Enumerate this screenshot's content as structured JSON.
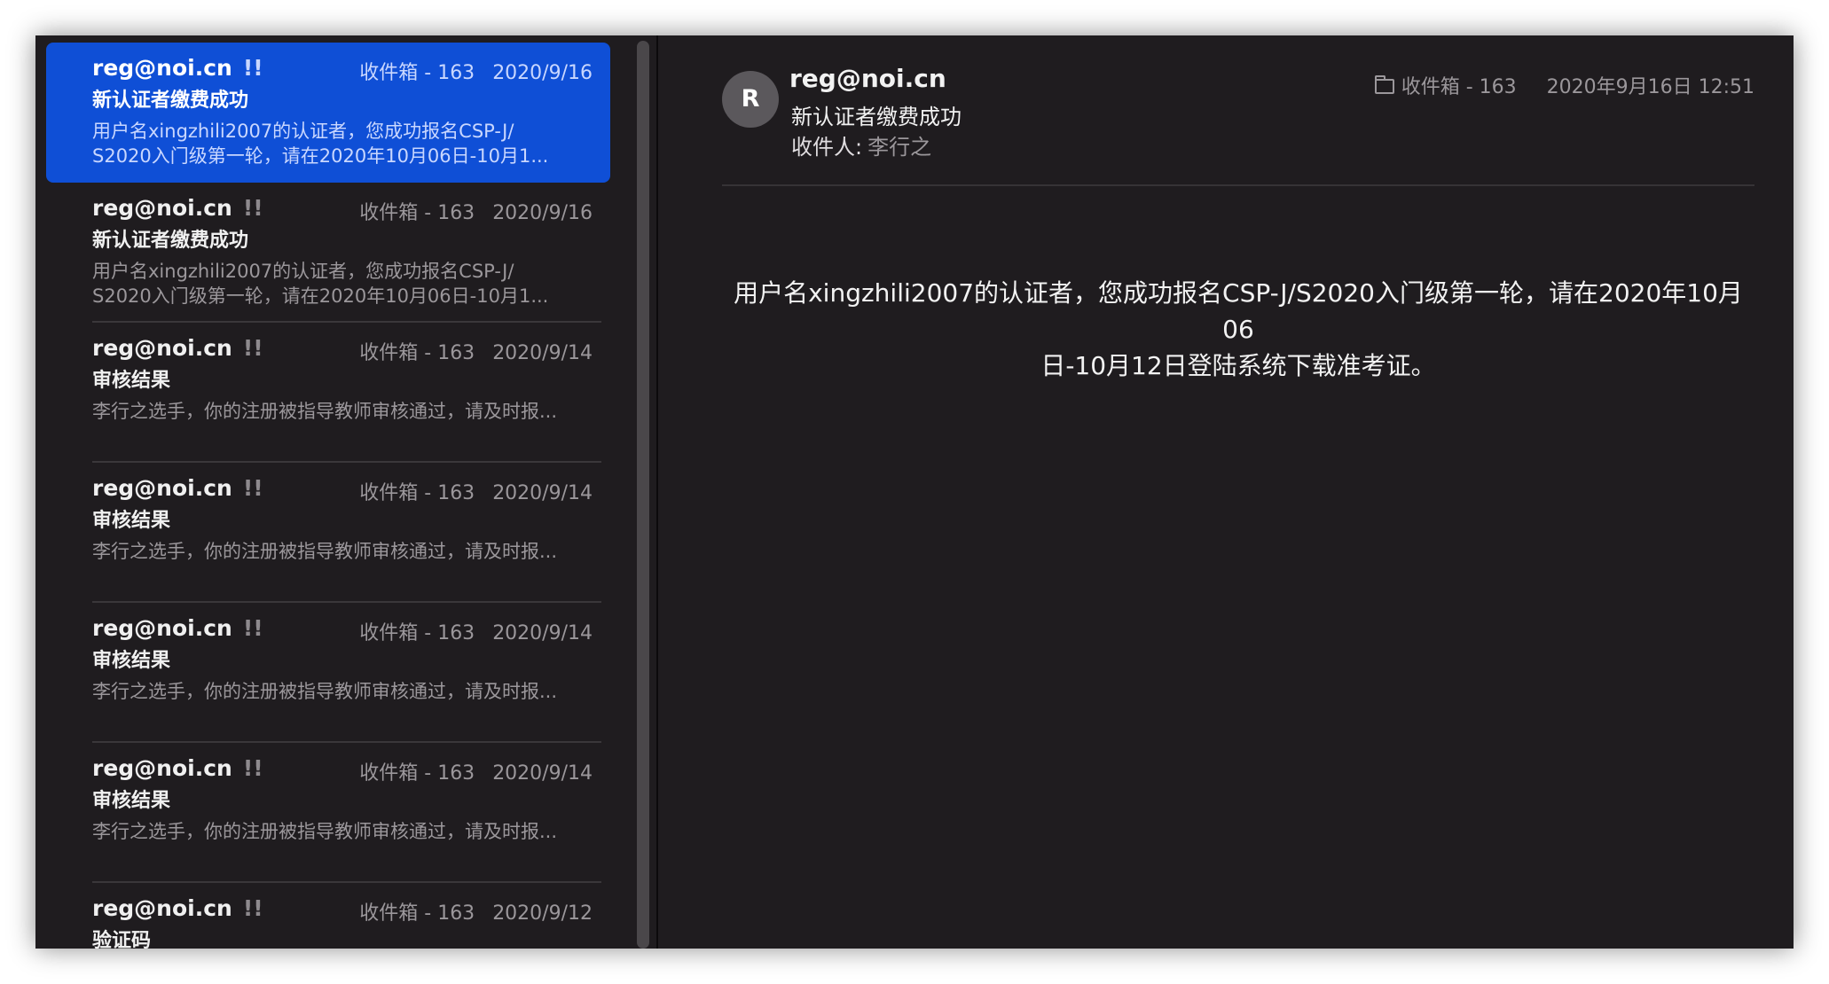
{
  "colors": {
    "window_bg": "#1f1c1f",
    "selected_bg": "#0f4fd6",
    "muted_text": "#9b979b",
    "avatar_bg": "#5b585c"
  },
  "mail_list": [
    {
      "sender": "reg@noi.cn",
      "flag": "!!",
      "folder": "收件箱 - 163",
      "date": "2020/9/16",
      "subject": "新认证者缴费成功",
      "preview_line1": "用户名xingzhili2007的认证者，您成功报名CSP-J/",
      "preview_line2": "S2020入门级第一轮，请在2020年10月06日-10月1...",
      "selected": true
    },
    {
      "sender": "reg@noi.cn",
      "flag": "!!",
      "folder": "收件箱 - 163",
      "date": "2020/9/16",
      "subject": "新认证者缴费成功",
      "preview_line1": "用户名xingzhili2007的认证者，您成功报名CSP-J/",
      "preview_line2": "S2020入门级第一轮，请在2020年10月06日-10月1..."
    },
    {
      "sender": "reg@noi.cn",
      "flag": "!!",
      "folder": "收件箱 - 163",
      "date": "2020/9/14",
      "subject": "审核结果",
      "preview_line1": "李行之选手，你的注册被指导教师审核通过，请及时报...",
      "preview_line2": ""
    },
    {
      "sender": "reg@noi.cn",
      "flag": "!!",
      "folder": "收件箱 - 163",
      "date": "2020/9/14",
      "subject": "审核结果",
      "preview_line1": "李行之选手，你的注册被指导教师审核通过，请及时报...",
      "preview_line2": ""
    },
    {
      "sender": "reg@noi.cn",
      "flag": "!!",
      "folder": "收件箱 - 163",
      "date": "2020/9/14",
      "subject": "审核结果",
      "preview_line1": "李行之选手，你的注册被指导教师审核通过，请及时报...",
      "preview_line2": ""
    },
    {
      "sender": "reg@noi.cn",
      "flag": "!!",
      "folder": "收件箱 - 163",
      "date": "2020/9/14",
      "subject": "审核结果",
      "preview_line1": "李行之选手，你的注册被指导教师审核通过，请及时报...",
      "preview_line2": ""
    },
    {
      "sender": "reg@noi.cn",
      "flag": "!!",
      "folder": "收件箱 - 163",
      "date": "2020/9/12",
      "subject": "验证码",
      "preview_line1": "",
      "preview_line2": ""
    }
  ],
  "reader": {
    "avatar_initial": "R",
    "sender": "reg@noi.cn",
    "subject": "新认证者缴费成功",
    "to_label": "收件人:",
    "to_value": "李行之",
    "folder_icon": "folder-icon",
    "folder": "收件箱 - 163",
    "datetime": "2020年9月16日 12:51",
    "body_line1": "用户名xingzhili2007的认证者，您成功报名CSP-J/S2020入门级第一轮，请在2020年10月06",
    "body_line2": "日-10月12日登陆系统下载准考证。"
  }
}
